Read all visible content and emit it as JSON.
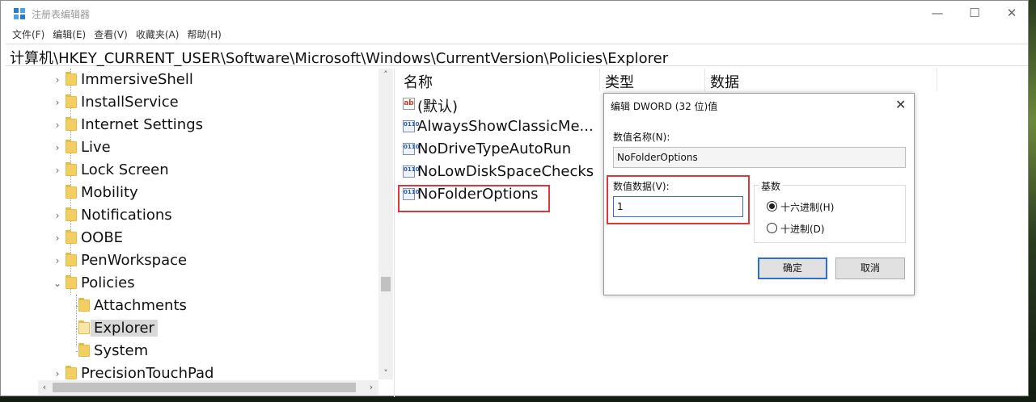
{
  "window": {
    "title": "注册表编辑器",
    "min_glyph": "—",
    "max_glyph": "☐",
    "close_glyph": "✕"
  },
  "menu": [
    "文件(F)",
    "编辑(E)",
    "查看(V)",
    "收藏夹(A)",
    "帮助(H)"
  ],
  "address": "计算机\\HKEY_CURRENT_USER\\Software\\Microsoft\\Windows\\CurrentVersion\\Policies\\Explorer",
  "tree": {
    "items": [
      {
        "label": "ImmersiveShell",
        "expander": "›"
      },
      {
        "label": "InstallService",
        "expander": "›"
      },
      {
        "label": "Internet Settings",
        "expander": "›"
      },
      {
        "label": "Live",
        "expander": "›"
      },
      {
        "label": "Lock Screen",
        "expander": "›"
      },
      {
        "label": "Mobility",
        "expander": ""
      },
      {
        "label": "Notifications",
        "expander": "›"
      },
      {
        "label": "OOBE",
        "expander": "›"
      },
      {
        "label": "PenWorkspace",
        "expander": "›"
      },
      {
        "label": "Policies",
        "expander": "⌄"
      },
      {
        "label": "Attachments",
        "expander": ""
      },
      {
        "label": "Explorer",
        "expander": "",
        "selected": true
      },
      {
        "label": "System",
        "expander": ""
      },
      {
        "label": "PrecisionTouchPad",
        "expander": "›"
      }
    ],
    "scroll_up": "˄",
    "scroll_down": "˅",
    "scroll_left": "‹",
    "scroll_right": "›"
  },
  "list": {
    "columns": [
      "名称",
      "类型",
      "数据"
    ],
    "rows": [
      {
        "name": "(默认)",
        "icon": "ab"
      },
      {
        "name": "AlwaysShowClassicMe...",
        "icon": "0110"
      },
      {
        "name": "NoDriveTypeAutoRun",
        "icon": "0110"
      },
      {
        "name": "NoLowDiskSpaceChecks",
        "icon": "0110"
      },
      {
        "name": "NoFolderOptions",
        "icon": "0110",
        "highlighted": true
      }
    ]
  },
  "dialog": {
    "title": "编辑 DWORD (32 位)值",
    "close_glyph": "✕",
    "value_name_label": "数值名称(N):",
    "value_name": "NoFolderOptions",
    "value_data_label": "数值数据(V):",
    "value_data": "1",
    "base_label": "基数",
    "hex_label": "十六进制(H)",
    "dec_label": "十进制(D)",
    "ok_label": "确定",
    "cancel_label": "取消"
  },
  "colors": {
    "highlight": "#d9393e",
    "focus": "#2d6fd1",
    "folder": "#f3cf61"
  }
}
